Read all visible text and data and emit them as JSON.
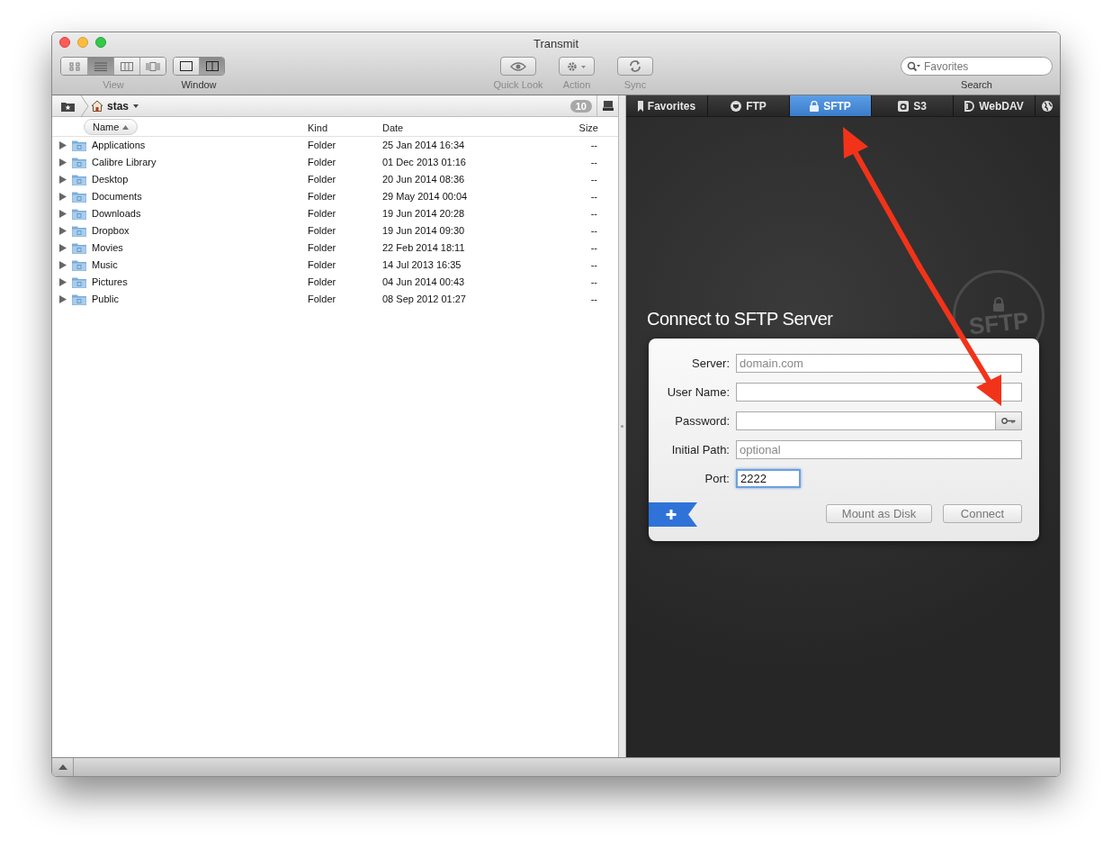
{
  "window": {
    "title": "Transmit"
  },
  "toolbar": {
    "view_label": "View",
    "window_label": "Window",
    "view_buttons": [
      {
        "selected": false
      },
      {
        "selected": true
      },
      {
        "selected": false
      },
      {
        "selected": false
      }
    ],
    "window_buttons": [
      {
        "selected": false
      },
      {
        "selected": true
      }
    ],
    "actions": [
      {
        "kind": "eye",
        "label": "Quick Look",
        "disabled": true
      },
      {
        "kind": "gear",
        "label": "Action",
        "disabled": true
      },
      {
        "kind": "sync",
        "label": "Sync",
        "disabled": true
      }
    ],
    "search": {
      "placeholder": "Favorites",
      "label": "Search"
    }
  },
  "local": {
    "path": "stas",
    "count": "10",
    "columns": [
      {
        "label": "Name",
        "sorted": true
      },
      {
        "label": "Kind",
        "sorted": false
      },
      {
        "label": "Date",
        "sorted": false
      },
      {
        "label": "Size",
        "sorted": false
      }
    ],
    "rows": [
      {
        "name": "Applications",
        "kind": "Folder",
        "date": "25 Jan 2014 16:34",
        "size": "--"
      },
      {
        "name": "Calibre Library",
        "kind": "Folder",
        "date": "01 Dec 2013 01:16",
        "size": "--"
      },
      {
        "name": "Desktop",
        "kind": "Folder",
        "date": "20 Jun 2014 08:36",
        "size": "--"
      },
      {
        "name": "Documents",
        "kind": "Folder",
        "date": "29 May 2014 00:04",
        "size": "--"
      },
      {
        "name": "Downloads",
        "kind": "Folder",
        "date": "19 Jun 2014 20:28",
        "size": "--"
      },
      {
        "name": "Dropbox",
        "kind": "Folder",
        "date": "19 Jun 2014 09:30",
        "size": "--"
      },
      {
        "name": "Movies",
        "kind": "Folder",
        "date": "22 Feb 2014 18:11",
        "size": "--"
      },
      {
        "name": "Music",
        "kind": "Folder",
        "date": "14 Jul 2013 16:35",
        "size": "--"
      },
      {
        "name": "Pictures",
        "kind": "Folder",
        "date": "04 Jun 2014 00:43",
        "size": "--"
      },
      {
        "name": "Public",
        "kind": "Folder",
        "date": "08 Sep 2012 01:27",
        "size": "--"
      }
    ]
  },
  "remote": {
    "tabs": [
      {
        "kind": "bookmark",
        "label": "Favorites",
        "selected": false
      },
      {
        "kind": "ftp",
        "label": "FTP",
        "selected": false
      },
      {
        "kind": "lock",
        "label": "SFTP",
        "selected": true
      },
      {
        "kind": "s3",
        "label": "S3",
        "selected": false
      },
      {
        "kind": "webdav",
        "label": "WebDAV",
        "selected": false
      },
      {
        "kind": "globe",
        "selected": false
      }
    ],
    "stamp_text": "SFTP",
    "heading": "Connect to SFTP Server",
    "fields": [
      {
        "label": "Server:",
        "placeholder": "domain.com",
        "focused": false
      },
      {
        "label": "User Name:",
        "focused": false
      },
      {
        "label": "Password:",
        "focused": false,
        "key_button": true
      },
      {
        "label": "Initial Path:",
        "placeholder": "optional",
        "focused": false
      },
      {
        "label": "Port:",
        "value": "2222",
        "focused": true
      }
    ],
    "buttons": [
      {
        "label": "Mount as Disk",
        "disabled": true
      },
      {
        "label": "Connect",
        "disabled": true
      }
    ]
  }
}
